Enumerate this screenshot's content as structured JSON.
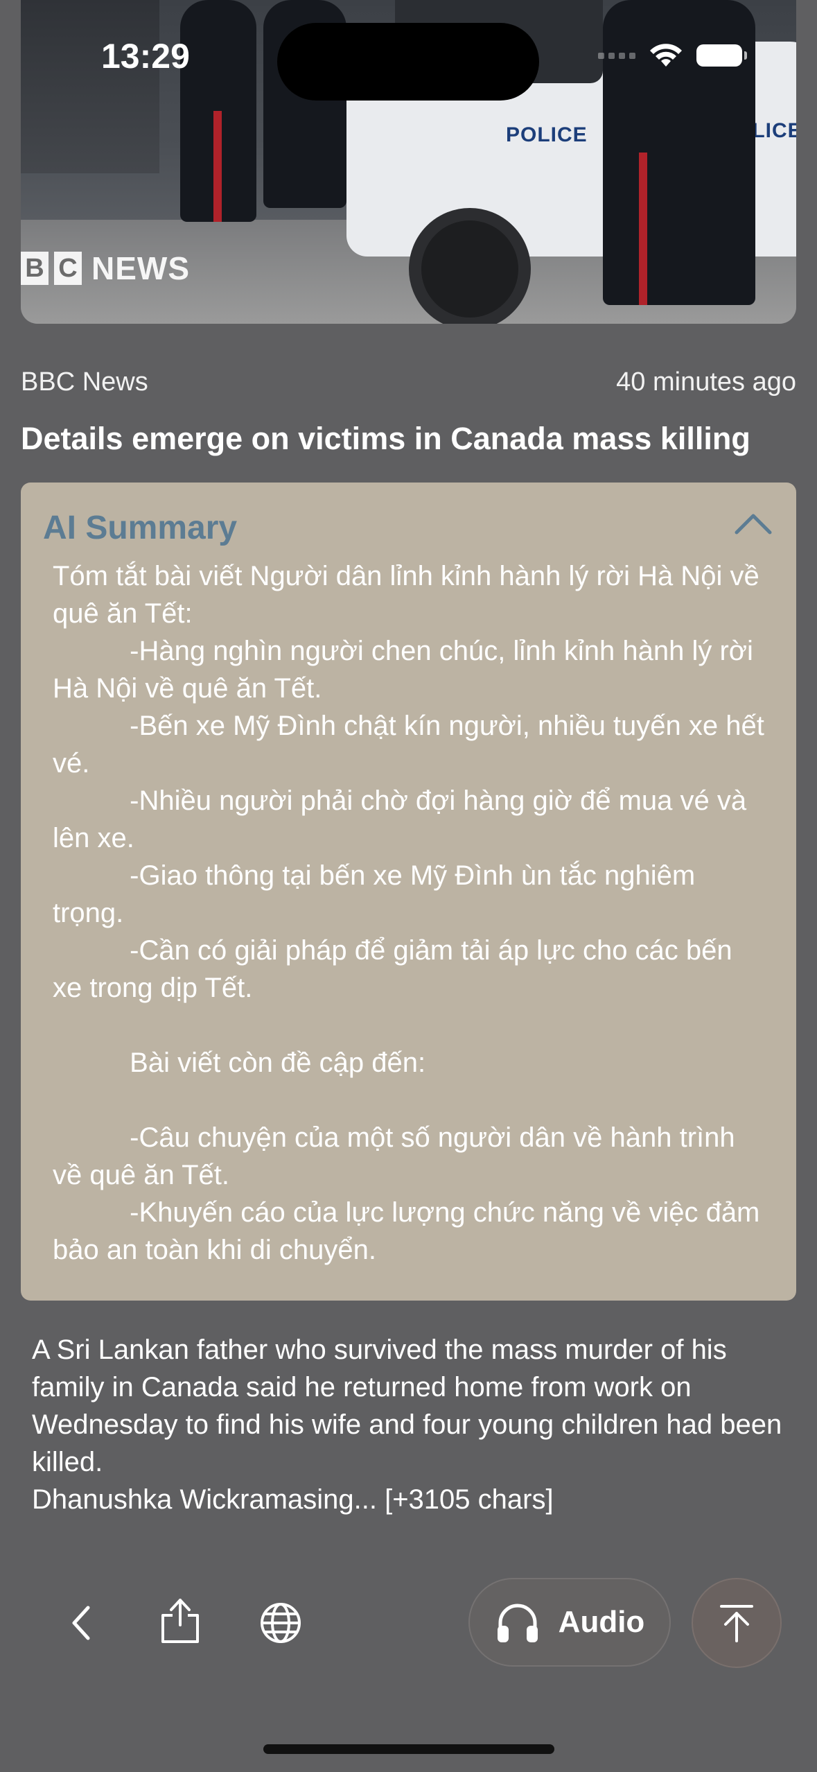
{
  "status_bar": {
    "time": "13:29"
  },
  "hero": {
    "brand_letters": [
      "B",
      "C"
    ],
    "brand_word": "NEWS",
    "vehicle_labels": [
      "POLICE",
      "POLICE"
    ]
  },
  "article": {
    "source": "BBC News",
    "timestamp": "40 minutes ago",
    "headline": "Details emerge on victims in Canada mass killing",
    "body": "A Sri Lankan father who survived the mass murder of his family in Canada said he returned home from work on Wednesday to find his wife and four young children had been killed.\nDhanushka Wickramasing... [+3105 chars]"
  },
  "summary": {
    "title": "AI Summary",
    "text": "Tóm tắt bài viết Người dân lỉnh kỉnh hành lý rời Hà Nội về quê ăn Tết:\n          -Hàng nghìn người chen chúc, lỉnh kỉnh hành lý rời Hà Nội về quê ăn Tết.\n          -Bến xe Mỹ Đình chật kín người, nhiều tuyến xe hết vé.\n          -Nhiều người phải chờ đợi hàng giờ để mua vé và lên xe.\n          -Giao thông tại bến xe Mỹ Đình ùn tắc nghiêm trọng.\n          -Cần có giải pháp để giảm tải áp lực cho các bến xe trong dịp Tết.\n\n          Bài viết còn đề cập đến:\n\n          -Câu chuyện của một số người dân về hành trình về quê ăn Tết.\n          -Khuyến cáo của lực lượng chức năng về việc đảm bảo an toàn khi di chuyển."
  },
  "toolbar": {
    "audio_label": "Audio",
    "icons": [
      "chevron-left-icon",
      "share-icon",
      "globe-icon",
      "headphones-icon",
      "scroll-to-top-icon"
    ]
  },
  "colors": {
    "background": "#5f5f61",
    "summary_card": "#bcb3a3",
    "summary_title": "#5c7c93"
  }
}
